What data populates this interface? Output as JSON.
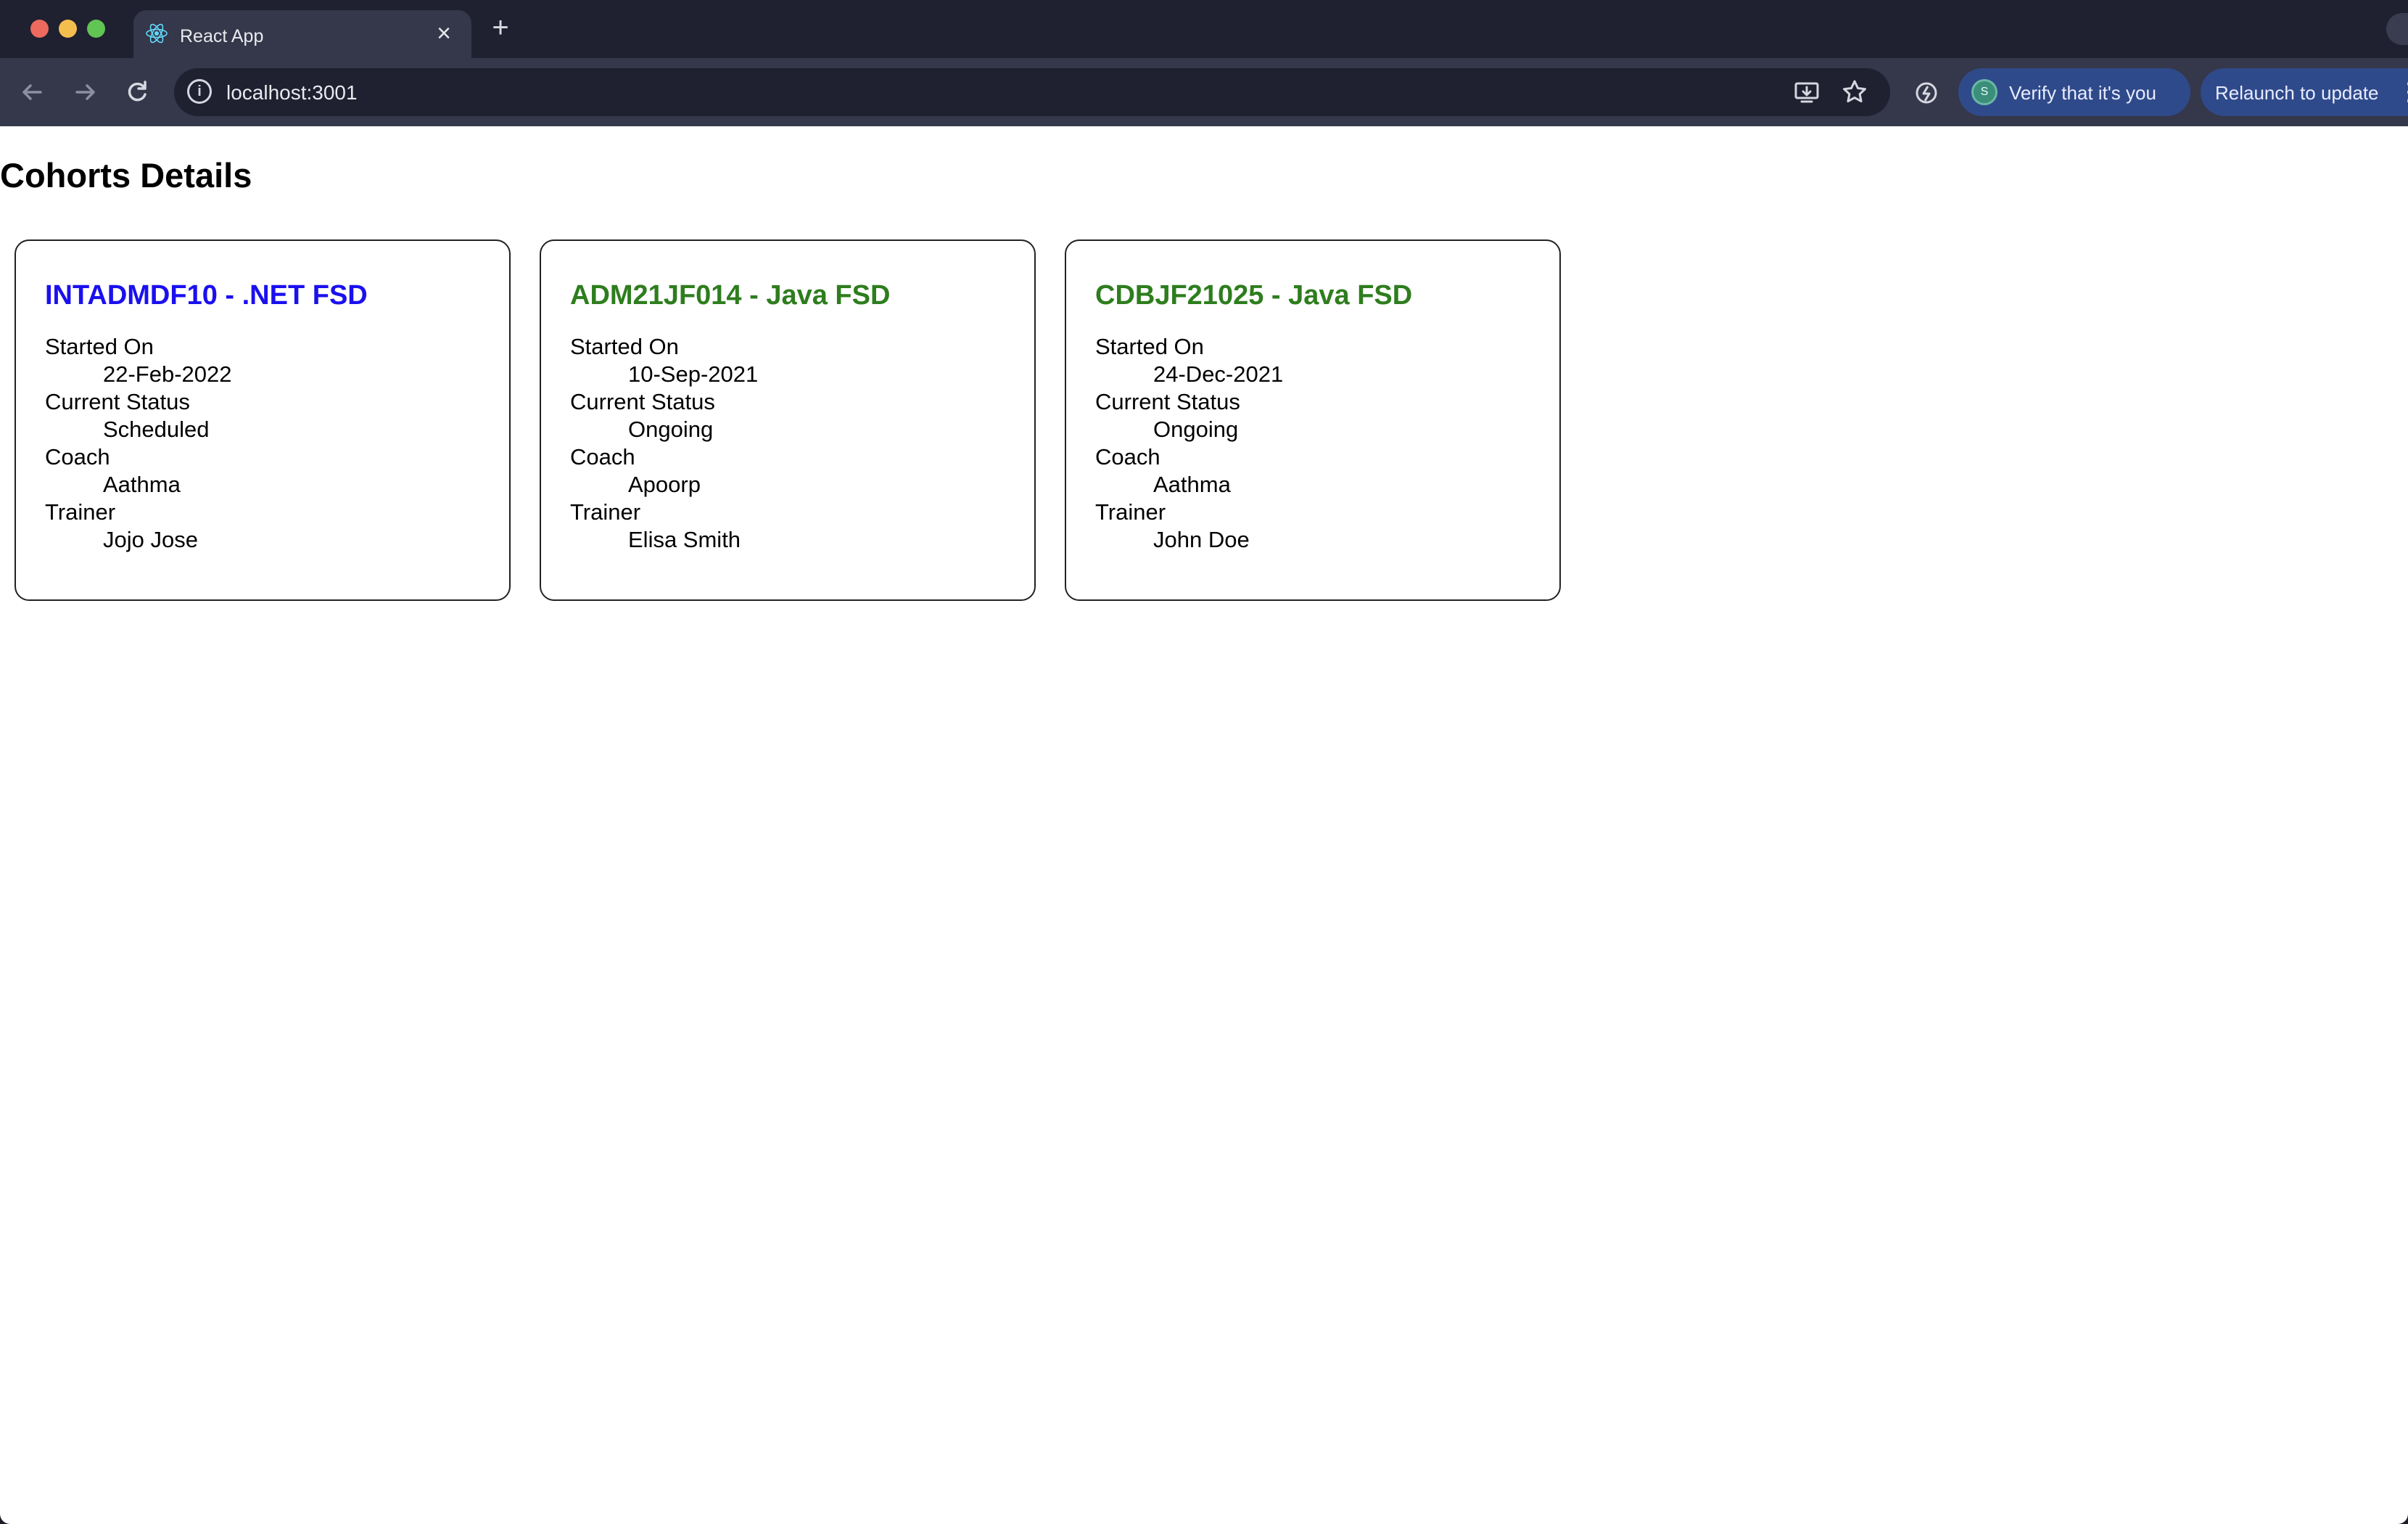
{
  "browser": {
    "tab_title": "React App",
    "tab_close": "×",
    "new_tab": "+",
    "url": "localhost:3001",
    "verify_label": "Verify that it's you",
    "verify_avatar_letter": "S",
    "relaunch_label": "Relaunch to update",
    "menu_icon": "⋮"
  },
  "page": {
    "heading": "Cohorts Details",
    "labels": {
      "started_on": "Started On",
      "current_status": "Current Status",
      "coach": "Coach",
      "trainer": "Trainer"
    },
    "cohorts": [
      {
        "title": "INTADMDF10 - .NET FSD",
        "title_color": "#1a10ee",
        "started_on": "22-Feb-2022",
        "current_status": "Scheduled",
        "coach": "Aathma",
        "trainer": "Jojo Jose"
      },
      {
        "title": "ADM21JF014 - Java FSD",
        "title_color": "#2e7d1e",
        "started_on": "10-Sep-2021",
        "current_status": "Ongoing",
        "coach": "Apoorp",
        "trainer": "Elisa Smith"
      },
      {
        "title": "CDBJF21025 - Java FSD",
        "title_color": "#2e7d1e",
        "started_on": "24-Dec-2021",
        "current_status": "Ongoing",
        "coach": "Aathma",
        "trainer": "John Doe"
      }
    ]
  }
}
